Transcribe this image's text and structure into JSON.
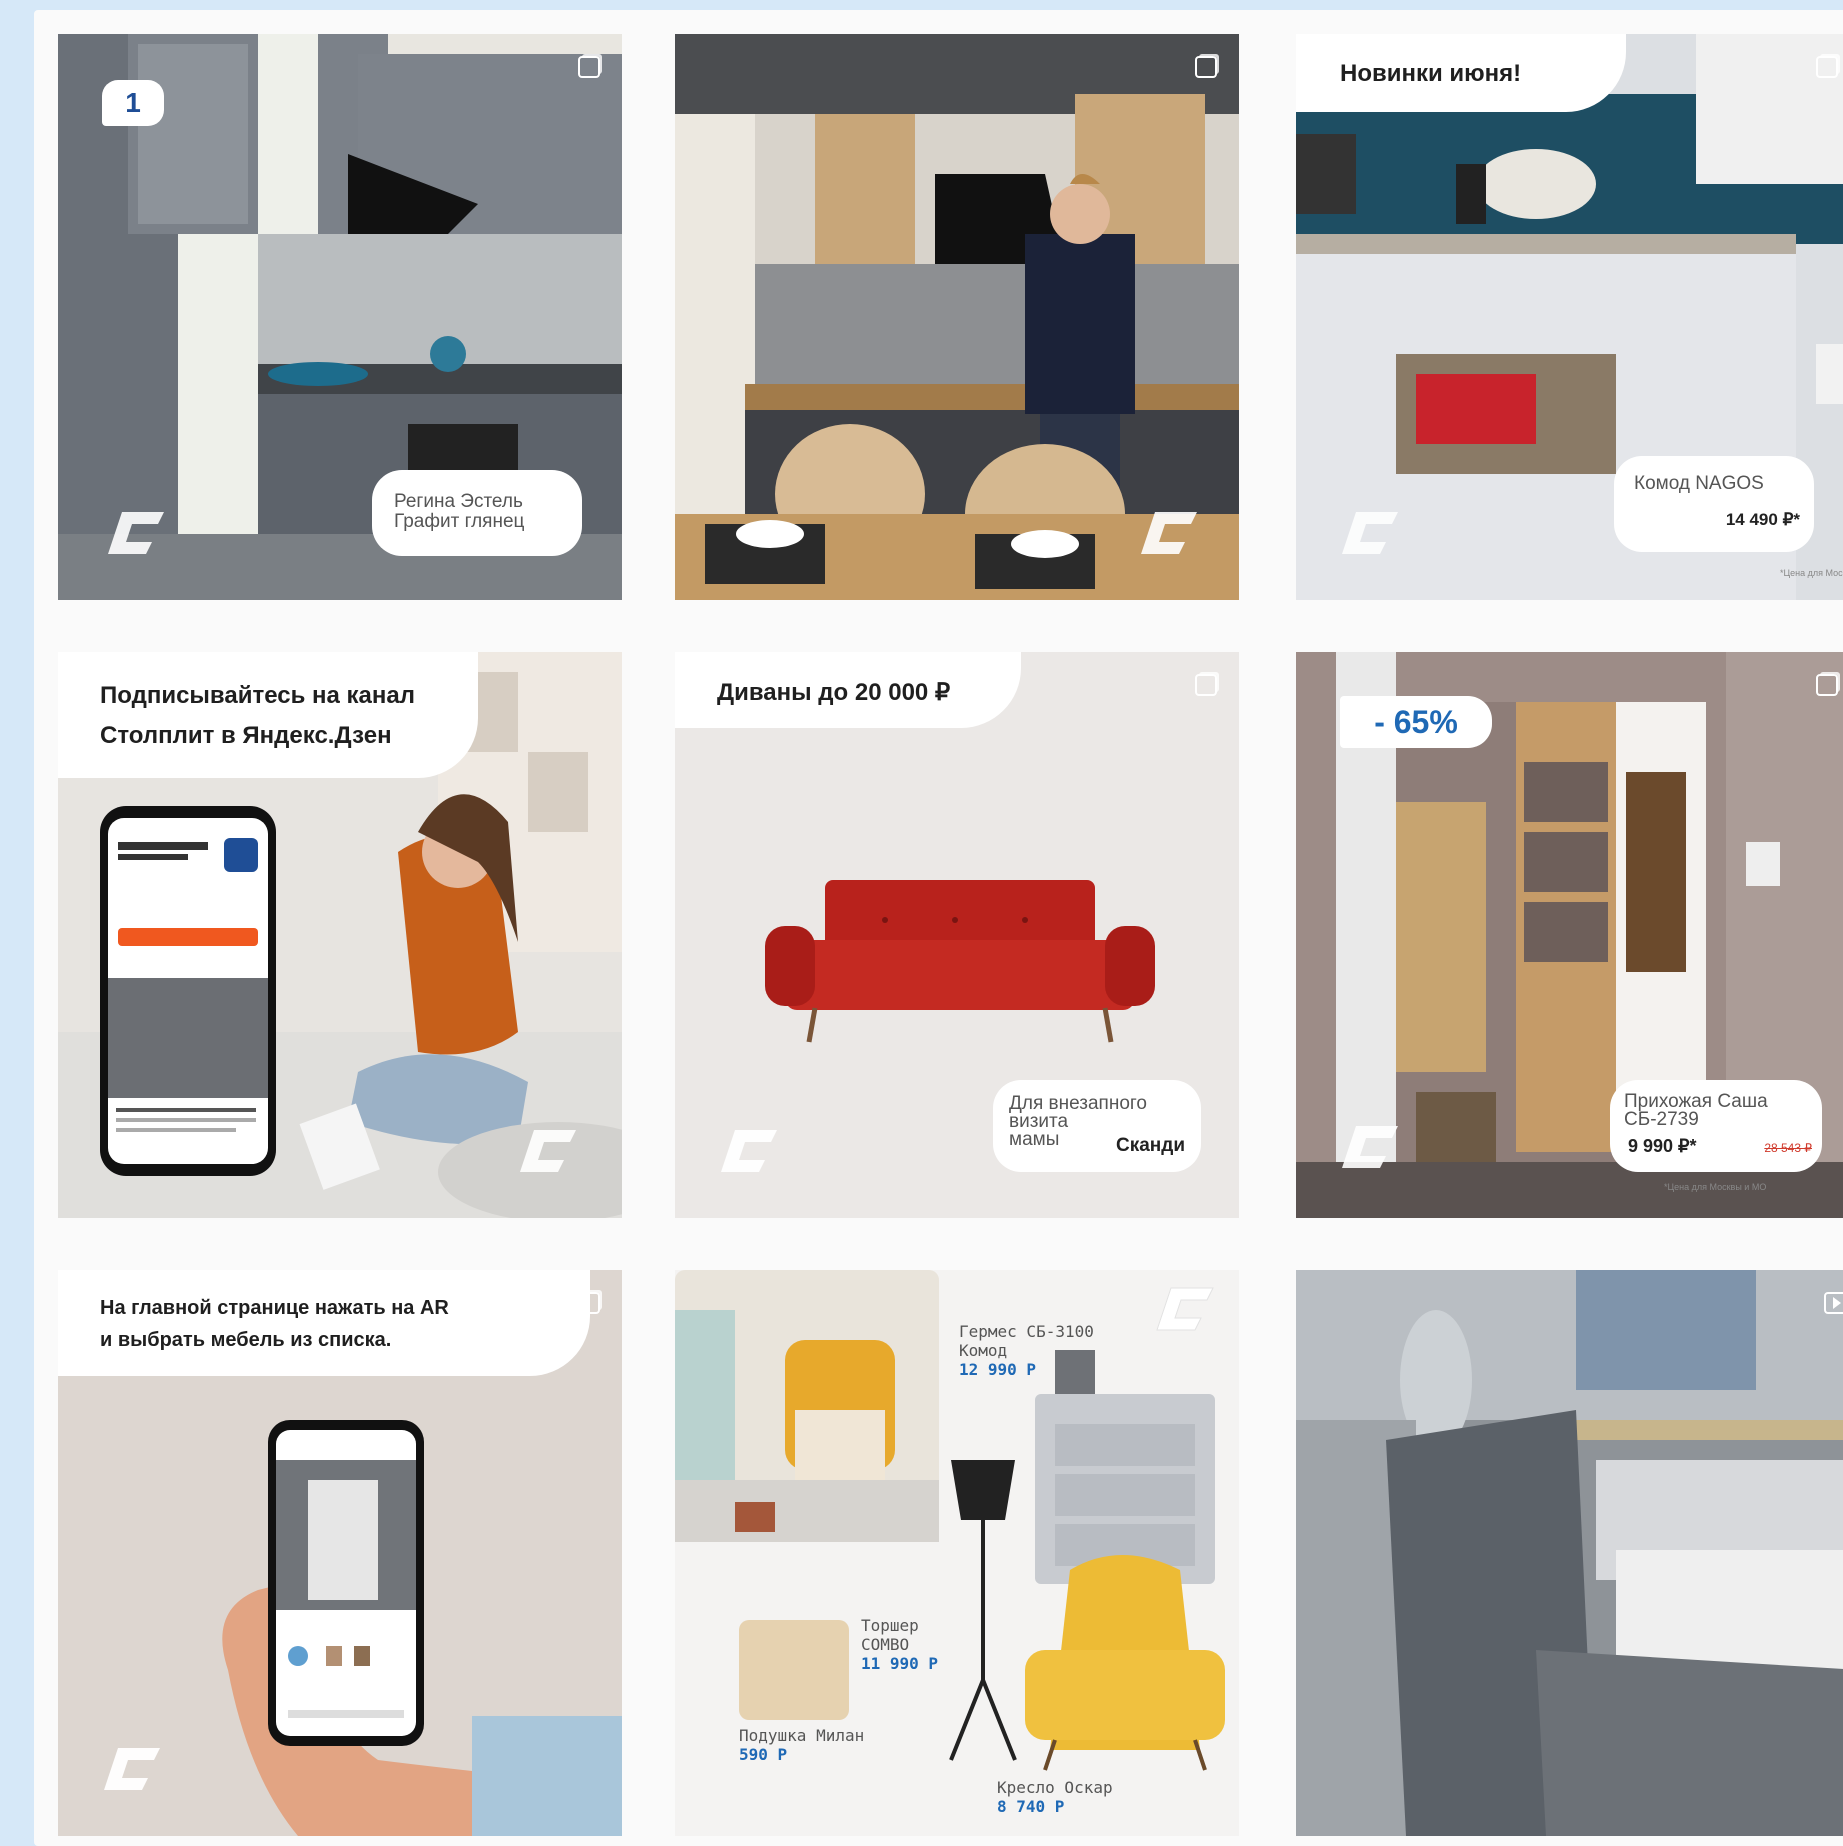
{
  "tiles": {
    "t1": {
      "badge": "1",
      "label_line1": "Регина Эстель",
      "label_line2": "Графит глянец"
    },
    "t2": {},
    "t3": {
      "headline": "Новинки июня!",
      "product": "Комод NAGOS",
      "price": "14 490 ₽*",
      "footnote": "*Цена для Москвы"
    },
    "t4": {
      "headline_line1": "Подписывайтесь на канал",
      "headline_line2": "Столплит в Яндекс.Дзен"
    },
    "t5": {
      "headline": "Диваны до 20 000 ₽",
      "caption_line1": "Для внезапного",
      "caption_line2": "визита",
      "caption_line3": "мамы",
      "style": "Сканди"
    },
    "t6": {
      "discount": "- 65%",
      "product_line1": "Прихожая Саша",
      "product_line2": "СБ-2739",
      "price": "9 990 ₽*",
      "old_price": "28 543 ₽",
      "footnote": "*Цена для Москвы и МО"
    },
    "t7": {
      "headline_line1": "На главной странице нажать на AR",
      "headline_line2": "и выбрать мебель из списка."
    },
    "t8": {
      "items": [
        {
          "line1": "Гермес СБ-3100",
          "line2": "Комод",
          "price": "12 990 Р"
        },
        {
          "line1": "Торшер",
          "line2": "СОМВО",
          "price": "11 990 Р"
        },
        {
          "line1": "Подушка Милан",
          "line2": "",
          "price": "590 Р"
        },
        {
          "line1": "Кресло Оскар",
          "line2": "",
          "price": "8 740 Р"
        }
      ]
    },
    "t9": {}
  },
  "colors": {
    "brand_blue": "#1f69b5",
    "page_bg": "#d6e8f8"
  }
}
